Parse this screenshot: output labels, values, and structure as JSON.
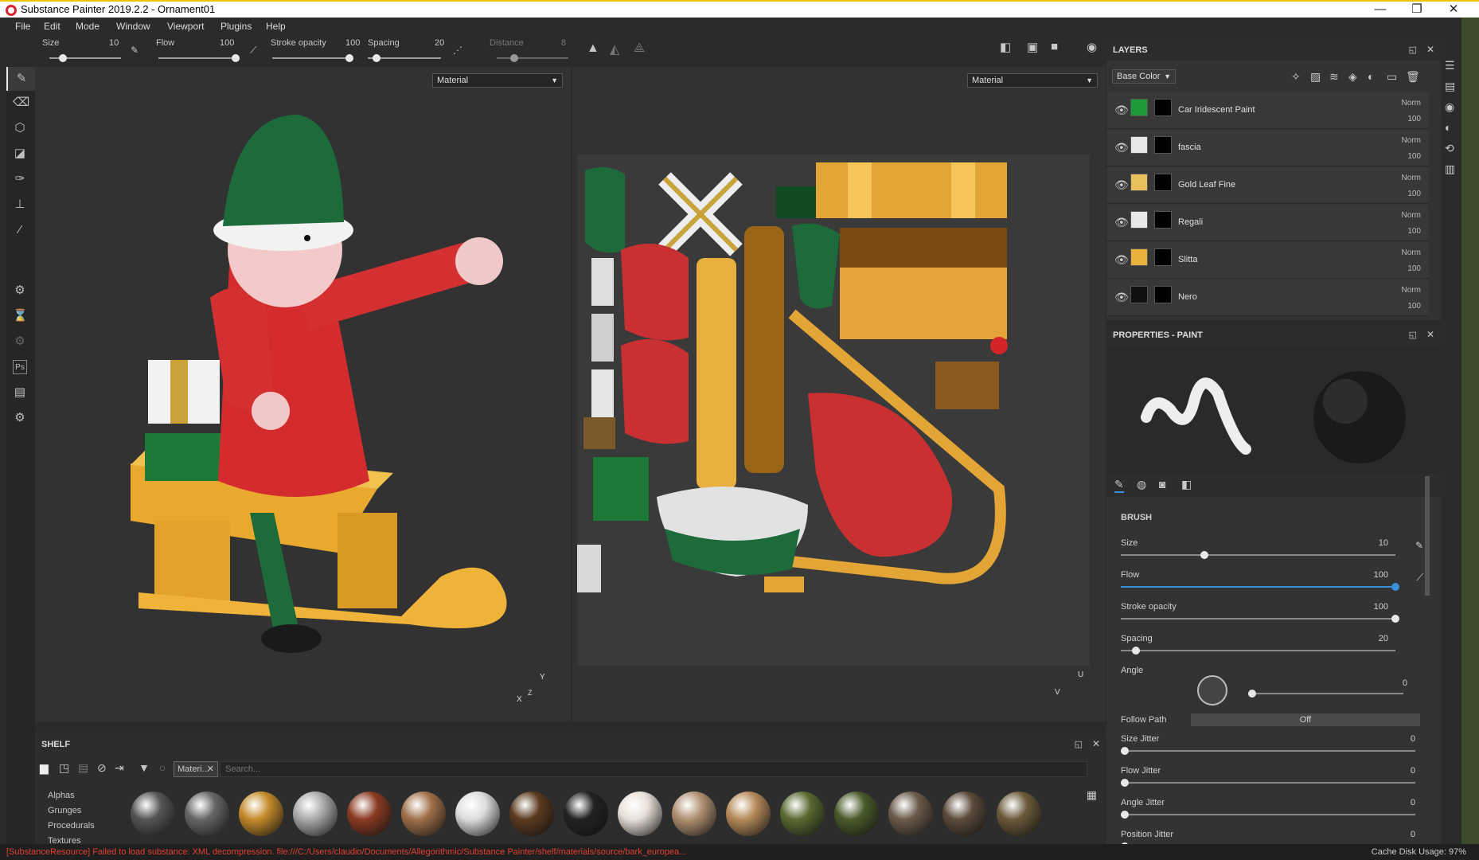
{
  "app": {
    "title": "Substance Painter 2019.2.2 - Ornament01",
    "controls": [
      "—",
      "❐",
      "✕"
    ]
  },
  "menu": [
    "File",
    "Edit",
    "Mode",
    "Window",
    "Viewport",
    "Plugins",
    "Help"
  ],
  "tool_options": {
    "size": {
      "label": "Size",
      "value": "10",
      "fraction": 0.2
    },
    "flow": {
      "label": "Flow",
      "value": "100",
      "fraction": 1.0
    },
    "stroke_opacity": {
      "label": "Stroke opacity",
      "value": "100",
      "fraction": 1.0
    },
    "spacing": {
      "label": "Spacing",
      "value": "20",
      "fraction": 0.08
    },
    "distance": {
      "label": "Distance",
      "value": "8",
      "fraction": 0.2
    }
  },
  "viewport3d": {
    "mode": "Material"
  },
  "viewport2d": {
    "mode": "Material"
  },
  "layers_panel": {
    "title": "LAYERS",
    "channel": "Base Color",
    "layers": [
      {
        "name": "Car Iridescent Paint",
        "blend": "Norm",
        "opacity": "100",
        "color": "#1f9a3a"
      },
      {
        "name": "fascia",
        "blend": "Norm",
        "opacity": "100",
        "color": "#e8e8e8"
      },
      {
        "name": "Gold Leaf Fine",
        "blend": "Norm",
        "opacity": "100",
        "color": "#e9c15a"
      },
      {
        "name": "Regali",
        "blend": "Norm",
        "opacity": "100",
        "color": "#e8e8e8"
      },
      {
        "name": "Slitta",
        "blend": "Norm",
        "opacity": "100",
        "color": "#eab03a"
      },
      {
        "name": "Nero",
        "blend": "Norm",
        "opacity": "100",
        "color": "#111111"
      }
    ]
  },
  "properties": {
    "title": "PROPERTIES - PAINT",
    "section": "BRUSH",
    "size": {
      "label": "Size",
      "value": "10",
      "fraction": 0.2
    },
    "flow": {
      "label": "Flow",
      "value": "100",
      "fraction": 1.0
    },
    "stroke_opacity": {
      "label": "Stroke opacity",
      "value": "100",
      "fraction": 1.0
    },
    "spacing": {
      "label": "Spacing",
      "value": "20",
      "fraction": 0.02
    },
    "angle": {
      "label": "Angle",
      "value": "0"
    },
    "follow_path": {
      "label": "Follow Path",
      "value": "Off"
    },
    "size_jitter": {
      "label": "Size Jitter",
      "value": "0"
    },
    "flow_jitter": {
      "label": "Flow Jitter",
      "value": "0"
    },
    "angle_jitter": {
      "label": "Angle Jitter",
      "value": "0"
    },
    "position_jitter": {
      "label": "Position Jitter",
      "value": "0"
    }
  },
  "shelf": {
    "title": "SHELF",
    "filter_tag": "Materi...",
    "search_placeholder": "Search...",
    "categories": [
      "Alphas",
      "Grunges",
      "Procedurals",
      "Textures"
    ],
    "material_colors": [
      "#555",
      "#666",
      "#c48a2a",
      "#aaa",
      "#8a3a22",
      "#a0704a",
      "#ddd",
      "#5a3a1e",
      "#222",
      "#e8e0d8",
      "#b09070",
      "#b68a5a",
      "#5a6a30",
      "#4a5a2a",
      "#6a5a4a",
      "#5a4a3a",
      "#6a5a3a"
    ]
  },
  "status": {
    "error": "[SubstanceResource] Failed to load substance: XML decompression. file:///C:/Users/claudio/Documents/Allegorithmic/Substance Painter/shelf/materials/source/bark_europea...",
    "cache": "Cache Disk Usage:  97%"
  }
}
